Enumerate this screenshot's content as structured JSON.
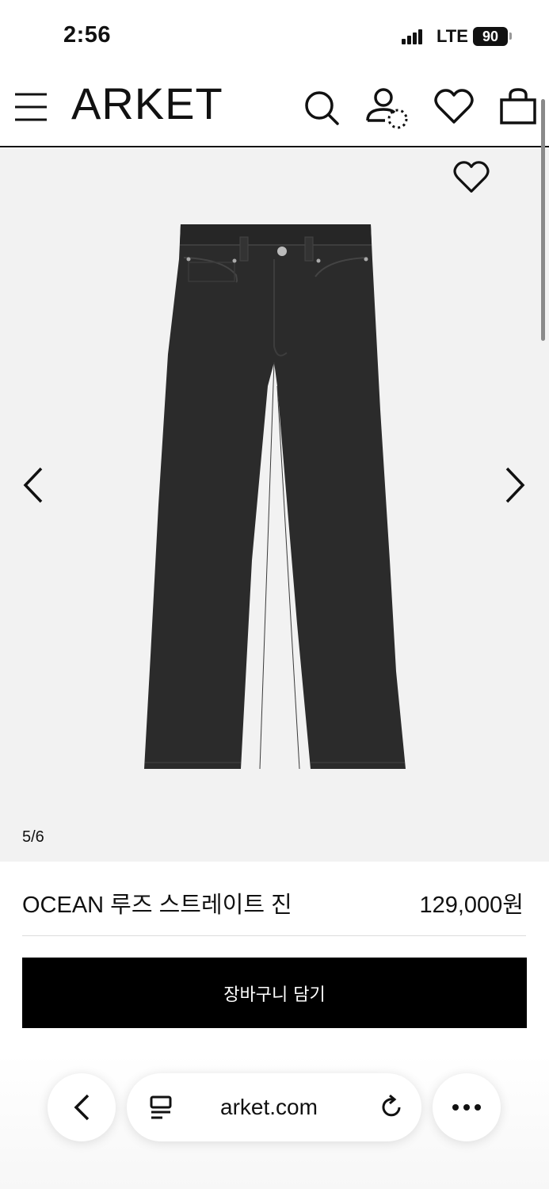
{
  "status_bar": {
    "time": "2:56",
    "network": "LTE",
    "battery": "90"
  },
  "header": {
    "logo": "ARKET",
    "icons": [
      "menu-icon",
      "search-icon",
      "account-icon",
      "wishlist-icon",
      "bag-icon"
    ]
  },
  "gallery": {
    "counter": "5/6",
    "background": "#f2f2f2",
    "product_color": "#2b2b2b"
  },
  "product": {
    "name": "OCEAN 루즈 스트레이트 진",
    "price": "129,000원"
  },
  "actions": {
    "add_to_bag": "장바구니 담기"
  },
  "browser": {
    "url": "arket.com"
  }
}
